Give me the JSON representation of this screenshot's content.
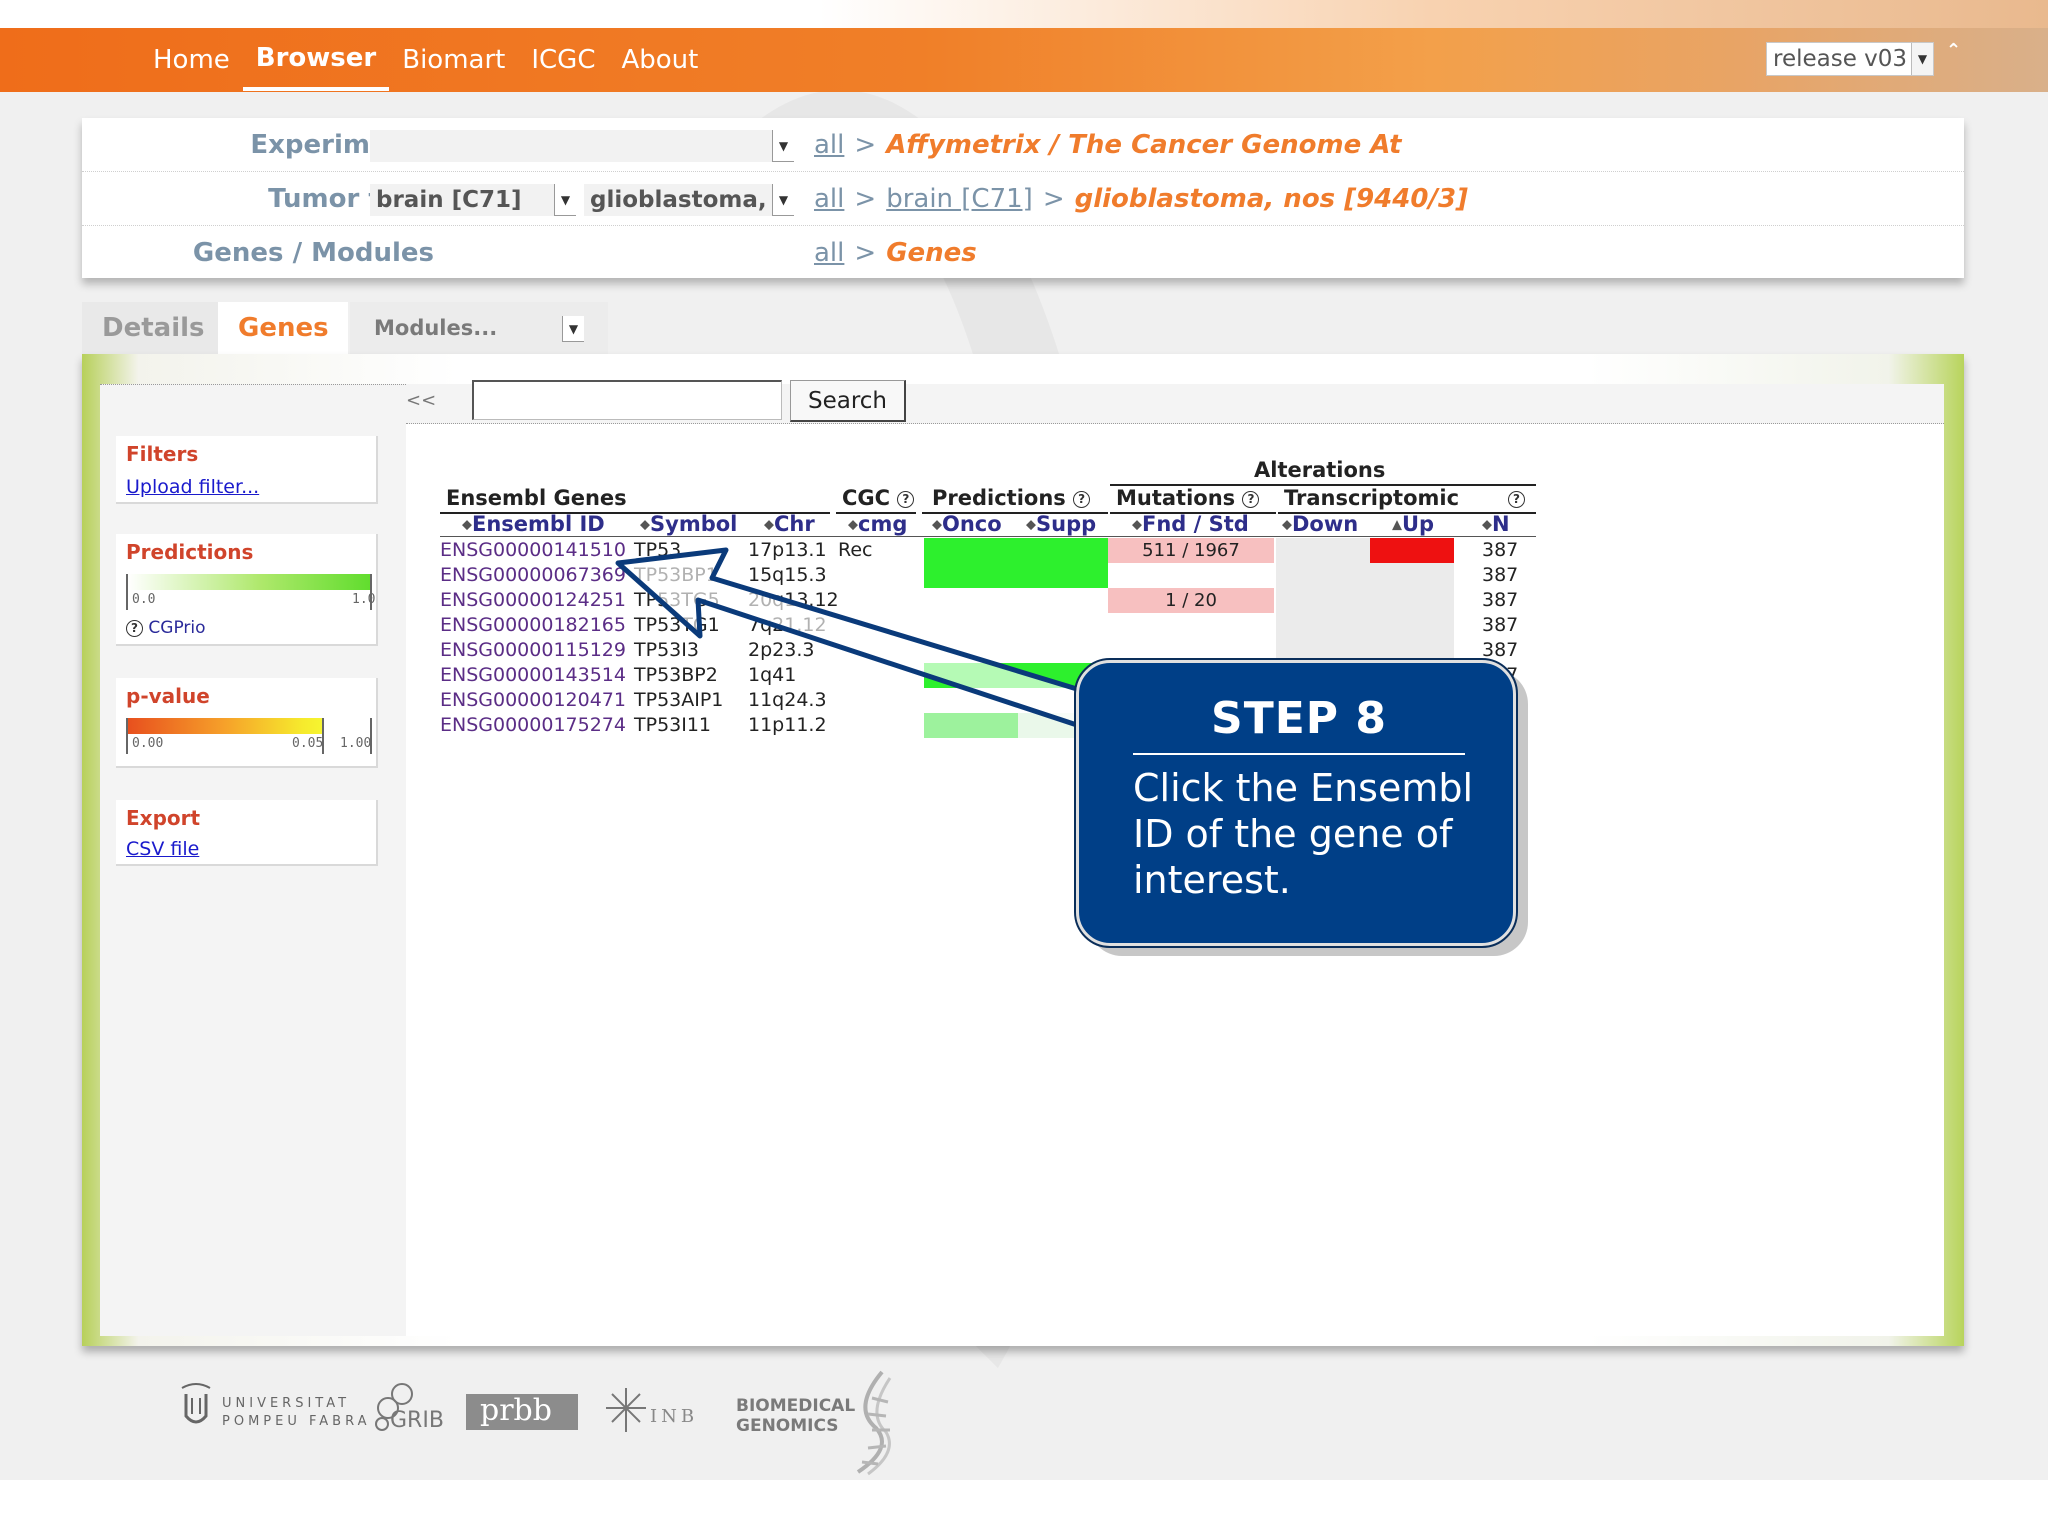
{
  "nav": {
    "items": [
      {
        "label": "Home",
        "active": false
      },
      {
        "label": "Browser",
        "active": true
      },
      {
        "label": "Biomart",
        "active": false
      },
      {
        "label": "ICGC",
        "active": false
      },
      {
        "label": "About",
        "active": false
      }
    ],
    "release": "release v03"
  },
  "selection": {
    "experiments": {
      "label": "Experiments",
      "value": "",
      "breadcrumb_all": "all",
      "current": "Affymetrix / The Cancer Genome At"
    },
    "tumor_type": {
      "label": "Tumor type",
      "value1": "brain [C71]",
      "value2": "glioblastoma, nos",
      "breadcrumb_all": "all",
      "breadcrumb_mid": "brain [C71]",
      "current": "glioblastoma, nos [9440/3]"
    },
    "genes_modules": {
      "label": "Genes / Modules",
      "breadcrumb_all": "all",
      "current": "Genes"
    }
  },
  "tabs": {
    "details": "Details",
    "genes": "Genes",
    "modules": "Modules..."
  },
  "toolbar": {
    "collapse": "<<",
    "search_value": "",
    "search_label": "Search"
  },
  "sidebar": {
    "filters": {
      "title": "Filters",
      "link": "Upload filter..."
    },
    "predictions": {
      "title": "Predictions",
      "min": "0.0",
      "max": "1.0",
      "link": "CGPrio"
    },
    "pvalue": {
      "title": "p-value",
      "t0": "0.00",
      "t1": "0.05",
      "t2": "1.00"
    },
    "export": {
      "title": "Export",
      "link": "CSV file"
    }
  },
  "table": {
    "group_headers": {
      "ensembl_genes": "Ensembl Genes",
      "cgc": "CGC",
      "predictions": "Predictions",
      "alterations": "Alterations",
      "mutations": "Mutations",
      "transcriptomic": "Transcriptomic"
    },
    "columns": {
      "ensembl_id": "Ensembl ID",
      "symbol": "Symbol",
      "chr": "Chr",
      "cmg": "cmg",
      "onco": "Onco",
      "supp": "Supp",
      "fnd_std": "Fnd / Std",
      "down": "Down",
      "up": "Up",
      "n": "N"
    },
    "rows": [
      {
        "id": "ENSG00000141510",
        "symbol": "TP53",
        "chr": "17p13.1",
        "cgc": "Rec",
        "mut": "511 / 1967",
        "n": "387"
      },
      {
        "id": "ENSG00000067369",
        "symbol": "TP53BP1",
        "chr": "15q15.3",
        "cgc": "",
        "mut": "",
        "n": "387"
      },
      {
        "id": "ENSG00000124251",
        "symbol": "TP53TG5",
        "chr": "20q13.12",
        "cgc": "",
        "mut": "1 / 20",
        "n": "387"
      },
      {
        "id": "ENSG00000182165",
        "symbol": "TP53TG1",
        "chr": "7q21.12",
        "cgc": "",
        "mut": "",
        "n": "387"
      },
      {
        "id": "ENSG00000115129",
        "symbol": "TP53I3",
        "chr": "2p23.3",
        "cgc": "",
        "mut": "",
        "n": "387"
      },
      {
        "id": "ENSG00000143514",
        "symbol": "TP53BP2",
        "chr": "1q41",
        "cgc": "",
        "mut": "",
        "n": "387"
      },
      {
        "id": "ENSG00000120471",
        "symbol": "TP53AIP1",
        "chr": "11q24.3",
        "cgc": "",
        "mut": "",
        "n": ""
      },
      {
        "id": "ENSG00000175274",
        "symbol": "TP53I11",
        "chr": "11p11.2",
        "cgc": "",
        "mut": "",
        "n": ""
      }
    ]
  },
  "callout": {
    "title": "STEP 8",
    "text": "Click the Ensembl ID of the gene of interest."
  },
  "footer": {
    "upf": [
      "UNIVERSITAT",
      "POMPEU FABRA"
    ],
    "grib": "GRIB",
    "prbb": "prbb",
    "inb": "INB",
    "bg": [
      "BIOMEDICAL",
      "GENOMICS"
    ]
  },
  "colors": {
    "brand_orange": "#f07c2c",
    "nav_orange": "#ef6d1a",
    "callout_blue": "#003f87",
    "heat_green": "#2df02d",
    "heat_red": "#ee1111",
    "mut_pink": "#f7c0c0"
  }
}
